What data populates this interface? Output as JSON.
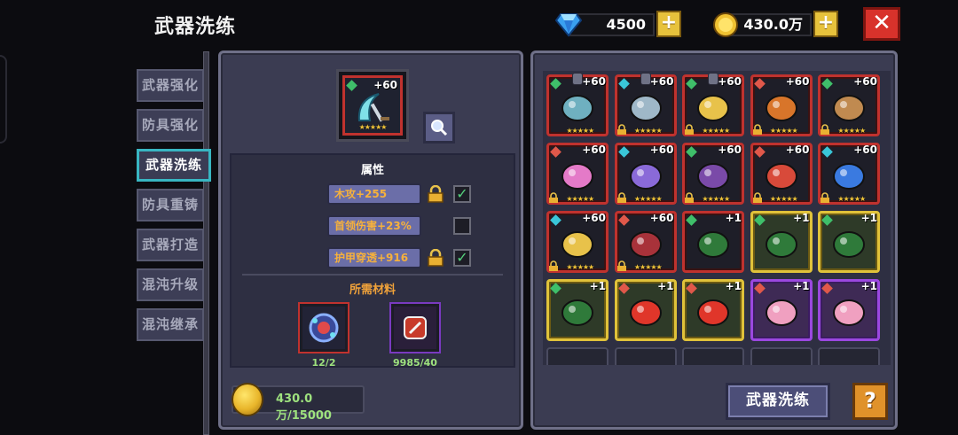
{
  "header": {
    "title": "武器洗练",
    "diamonds": "4500",
    "gold": "430.0万",
    "plus_label": "+",
    "close_label": "✕"
  },
  "tabs": [
    {
      "label": "武器强化",
      "active": false
    },
    {
      "label": "防具强化",
      "active": false
    },
    {
      "label": "武器洗练",
      "active": true
    },
    {
      "label": "防具重铸",
      "active": false
    },
    {
      "label": "武器打造",
      "active": false
    },
    {
      "label": "混沌升级",
      "active": false
    },
    {
      "label": "混沌继承",
      "active": false
    }
  ],
  "selected_weapon": {
    "level": "+60",
    "stars": "★★★★★",
    "icon": "crescent-blade-icon"
  },
  "attributes": {
    "title": "属性",
    "rows": [
      {
        "text": "木攻+255",
        "locked": true,
        "checked": true
      },
      {
        "text": "首领伤害+23%",
        "locked": false,
        "checked": false
      },
      {
        "text": "护甲穿透+916",
        "locked": true,
        "checked": true
      }
    ]
  },
  "materials": {
    "title": "所需材料",
    "items": [
      {
        "icon": "blue-gem-orb-icon",
        "count": "12/2"
      },
      {
        "icon": "red-rune-stone-icon",
        "count": "9985/40"
      }
    ]
  },
  "cost": {
    "text": "430.0万/15000"
  },
  "inventory": [
    {
      "level": "+60",
      "rarity": "red",
      "stars": "★★★★★",
      "pinned": true,
      "locked": false,
      "art": "#6fb0c0",
      "gem": "#3fbf6a"
    },
    {
      "level": "+60",
      "rarity": "red",
      "stars": "★★★★★",
      "pinned": true,
      "locked": true,
      "art": "#9fb8c8",
      "gem": "#3ac6d8"
    },
    {
      "level": "+60",
      "rarity": "red",
      "stars": "★★★★★",
      "pinned": true,
      "locked": true,
      "art": "#e8c24a",
      "gem": "#3fbf6a"
    },
    {
      "level": "+60",
      "rarity": "red",
      "stars": "★★★★★",
      "pinned": false,
      "locked": true,
      "art": "#d8752a",
      "gem": "#e0584a"
    },
    {
      "level": "+60",
      "rarity": "red",
      "stars": "★★★★★",
      "pinned": false,
      "locked": true,
      "art": "#c08a50",
      "gem": "#3fbf6a"
    },
    {
      "level": "+60",
      "rarity": "red",
      "stars": "★★★★★",
      "pinned": false,
      "locked": true,
      "art": "#e47ac8",
      "gem": "#e0584a"
    },
    {
      "level": "+60",
      "rarity": "red",
      "stars": "★★★★★",
      "pinned": false,
      "locked": true,
      "art": "#8a6ad8",
      "gem": "#3ac6d8"
    },
    {
      "level": "+60",
      "rarity": "red",
      "stars": "★★★★★",
      "pinned": false,
      "locked": true,
      "art": "#7a4aa8",
      "gem": "#3fbf6a"
    },
    {
      "level": "+60",
      "rarity": "red",
      "stars": "★★★★★",
      "pinned": false,
      "locked": true,
      "art": "#d84a3a",
      "gem": "#e0584a"
    },
    {
      "level": "+60",
      "rarity": "red",
      "stars": "★★★★★",
      "pinned": false,
      "locked": true,
      "art": "#3a7ae0",
      "gem": "#3ac6d8"
    },
    {
      "level": "+60",
      "rarity": "red",
      "stars": "★★★★★",
      "pinned": false,
      "locked": true,
      "art": "#e8c24a",
      "gem": "#3ac6d8"
    },
    {
      "level": "+60",
      "rarity": "red",
      "stars": "★★★★★",
      "pinned": false,
      "locked": true,
      "art": "#a8323a",
      "gem": "#e0584a"
    },
    {
      "level": "+1",
      "rarity": "red",
      "stars": "",
      "pinned": false,
      "locked": false,
      "art": "#2f7a3a",
      "gem": "#3fbf6a"
    },
    {
      "level": "+1",
      "rarity": "gold",
      "stars": "",
      "pinned": false,
      "locked": false,
      "art": "#2f7a3a",
      "gem": "#3fbf6a"
    },
    {
      "level": "+1",
      "rarity": "gold",
      "stars": "",
      "pinned": false,
      "locked": false,
      "art": "#2f7a3a",
      "gem": "#3fbf6a"
    },
    {
      "level": "+1",
      "rarity": "gold",
      "stars": "",
      "pinned": false,
      "locked": false,
      "art": "#2f7a3a",
      "gem": "#3fbf6a"
    },
    {
      "level": "+1",
      "rarity": "gold",
      "stars": "",
      "pinned": false,
      "locked": false,
      "art": "#e0362a",
      "gem": "#e0584a"
    },
    {
      "level": "+1",
      "rarity": "gold",
      "stars": "",
      "pinned": false,
      "locked": false,
      "art": "#e0362a",
      "gem": "#e0584a"
    },
    {
      "level": "+1",
      "rarity": "purple",
      "stars": "",
      "pinned": false,
      "locked": false,
      "art": "#f0a0c0",
      "gem": "#e0584a"
    },
    {
      "level": "+1",
      "rarity": "purple",
      "stars": "",
      "pinned": false,
      "locked": false,
      "art": "#f0a0c0",
      "gem": "#e0584a"
    },
    {
      "level": "",
      "rarity": "dark",
      "stars": "",
      "pinned": false,
      "locked": false,
      "art": "",
      "gem": ""
    },
    {
      "level": "",
      "rarity": "dark",
      "stars": "",
      "pinned": false,
      "locked": false,
      "art": "",
      "gem": ""
    },
    {
      "level": "",
      "rarity": "dark",
      "stars": "",
      "pinned": false,
      "locked": false,
      "art": "",
      "gem": ""
    },
    {
      "level": "",
      "rarity": "dark",
      "stars": "",
      "pinned": false,
      "locked": false,
      "art": "",
      "gem": ""
    },
    {
      "level": "",
      "rarity": "dark",
      "stars": "",
      "pinned": false,
      "locked": false,
      "art": "",
      "gem": ""
    }
  ],
  "buttons": {
    "wash": "武器洗练",
    "help": "?"
  },
  "colors": {
    "accent_tab": "#38b6c2",
    "close": "#d8322b",
    "gold": "#e7c23c",
    "value_green": "#9ee27e",
    "attr_text": "#f6b13c"
  }
}
